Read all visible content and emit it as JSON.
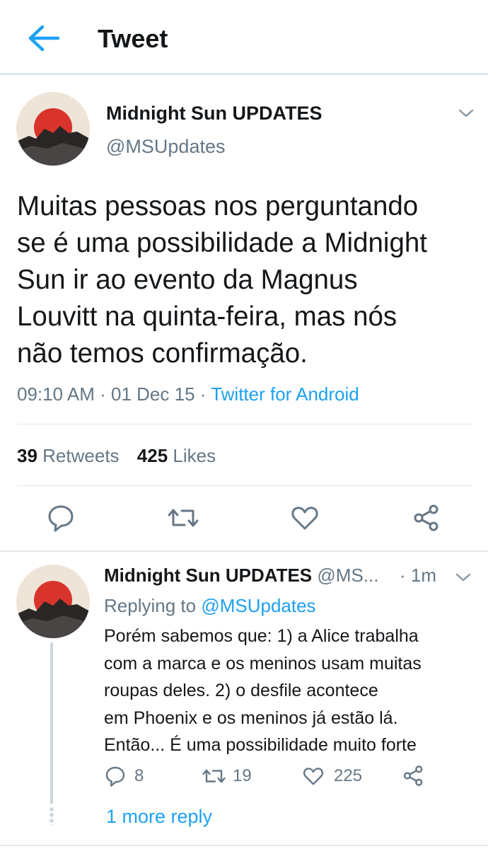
{
  "header": {
    "title": "Tweet",
    "back_icon": "arrow-left-icon"
  },
  "colors": {
    "accent": "#1da1f2",
    "muted": "#657786",
    "text": "#14171a",
    "border": "#e1e8ed"
  },
  "tweet": {
    "display_name": "Midnight Sun UPDATES",
    "handle": "@MSUpdates",
    "text_lines": [
      "Muitas pessoas nos perguntando",
      "se é uma possibilidade a Midnight",
      "Sun ir ao evento da Magnus",
      "Louvitt na quinta-feira, mas nós",
      "não temos confirmação."
    ],
    "time": "09:10 AM",
    "date": "01 Dec 15",
    "separator": "·",
    "client": "Twitter for Android",
    "retweets_count": "39",
    "retweets_label": "Retweets",
    "likes_count": "425",
    "likes_label": "Likes"
  },
  "reply": {
    "display_name": "Midnight Sun UPDATES",
    "handle": "@MS...",
    "time": "· 1m",
    "replying_prefix": "Replying to",
    "replying_handle": "@MSUpdates",
    "text_lines": [
      "Porém sabemos que: 1) a Alice trabalha",
      "com a marca e os meninos usam muitas",
      "roupas deles. 2) o desfile acontece",
      "em Phoenix e os meninos já estão lá.",
      "Então... É uma possibilidade muito forte"
    ],
    "reply_count": "8",
    "retweet_count": "19",
    "like_count": "225",
    "more_replies": "1 more reply"
  }
}
